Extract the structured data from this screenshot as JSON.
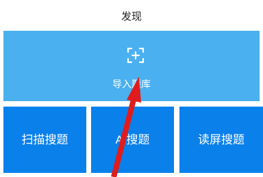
{
  "header": {
    "title": "发现"
  },
  "import_card": {
    "label": "导入题库",
    "icon": "scan-plus-icon"
  },
  "tiles": [
    {
      "label": "扫描搜题"
    },
    {
      "label": "AI搜题"
    },
    {
      "label": "读屏搜题"
    }
  ],
  "colors": {
    "import_bg": "#4ab0ef",
    "tile_bg": "#0a80eb",
    "arrow": "#e01c1c"
  }
}
